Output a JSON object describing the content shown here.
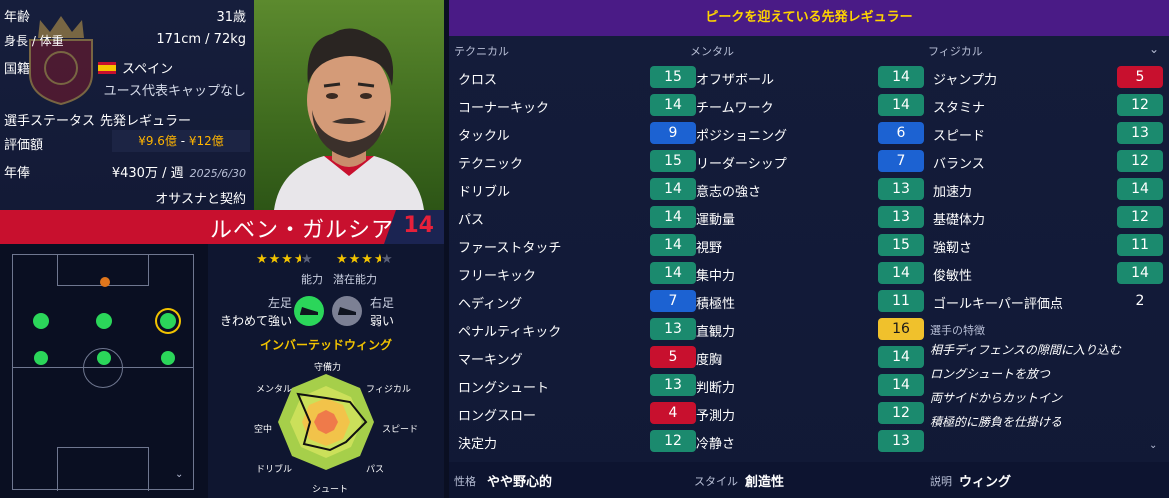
{
  "info": {
    "age_label": "年齢",
    "age_value": "31歳",
    "hw_label": "身長 / 体重",
    "hw_value": "171cm / 72kg",
    "nation_label": "国籍",
    "nation_value": "スペイン",
    "nation_sub": "ユース代表キャップなし",
    "status_label": "選手ステータス",
    "status_value": "先発レギュラー",
    "value_label": "評価額",
    "value_low": "¥9.6億",
    "value_sep": " - ",
    "value_high": "¥12億",
    "wage_label": "年俸",
    "wage_value": "¥430万 / 週",
    "wage_date": "2025/6/30",
    "contract": "オサスナと契約"
  },
  "player": {
    "name": "ルベン・ガルシア",
    "number": "14"
  },
  "ratings": {
    "ability_caption": "能力",
    "potential_caption": "潜在能力",
    "ability_stars": 3.5,
    "potential_stars": 3.5
  },
  "foot": {
    "left_label": "左足",
    "left_value": "きわめて強い",
    "right_label": "右足",
    "right_value": "弱い"
  },
  "role": "インバーテッドウィング",
  "radar": {
    "labels": [
      "守備力",
      "フィジカル",
      "スピード",
      "パス",
      "シュート",
      "ドリブル",
      "空中",
      "メンタル"
    ]
  },
  "banner": "ピークを迎えている先発レギュラー",
  "columns": {
    "technical": "テクニカル",
    "mental": "メンタル",
    "physical": "フィジカル"
  },
  "technical": [
    {
      "name": "クロス",
      "value": "15",
      "color": "green"
    },
    {
      "name": "コーナーキック",
      "value": "14",
      "color": "green"
    },
    {
      "name": "タックル",
      "value": "9",
      "color": "blue"
    },
    {
      "name": "テクニック",
      "value": "15",
      "color": "green"
    },
    {
      "name": "ドリブル",
      "value": "14",
      "color": "green"
    },
    {
      "name": "パス",
      "value": "14",
      "color": "green"
    },
    {
      "name": "ファーストタッチ",
      "value": "14",
      "color": "green"
    },
    {
      "name": "フリーキック",
      "value": "14",
      "color": "green"
    },
    {
      "name": "ヘディング",
      "value": "7",
      "color": "blue"
    },
    {
      "name": "ペナルティキック",
      "value": "13",
      "color": "green"
    },
    {
      "name": "マーキング",
      "value": "5",
      "color": "red"
    },
    {
      "name": "ロングシュート",
      "value": "13",
      "color": "green"
    },
    {
      "name": "ロングスロー",
      "value": "4",
      "color": "red"
    },
    {
      "name": "決定力",
      "value": "12",
      "color": "green"
    }
  ],
  "mental": [
    {
      "name": "オフザボール",
      "value": "14",
      "color": "green"
    },
    {
      "name": "チームワーク",
      "value": "14",
      "color": "green"
    },
    {
      "name": "ポジショニング",
      "value": "6",
      "color": "blue"
    },
    {
      "name": "リーダーシップ",
      "value": "7",
      "color": "blue"
    },
    {
      "name": "意志の強さ",
      "value": "13",
      "color": "green"
    },
    {
      "name": "運動量",
      "value": "13",
      "color": "green"
    },
    {
      "name": "視野",
      "value": "15",
      "color": "green"
    },
    {
      "name": "集中力",
      "value": "14",
      "color": "green"
    },
    {
      "name": "積極性",
      "value": "11",
      "color": "green"
    },
    {
      "name": "直観力",
      "value": "16",
      "color": "gold"
    },
    {
      "name": "度胸",
      "value": "14",
      "color": "green"
    },
    {
      "name": "判断力",
      "value": "14",
      "color": "green"
    },
    {
      "name": "予測力",
      "value": "12",
      "color": "green"
    },
    {
      "name": "冷静さ",
      "value": "13",
      "color": "green"
    }
  ],
  "physical": [
    {
      "name": "ジャンプ力",
      "value": "5",
      "color": "red"
    },
    {
      "name": "スタミナ",
      "value": "12",
      "color": "green"
    },
    {
      "name": "スピード",
      "value": "13",
      "color": "green"
    },
    {
      "name": "バランス",
      "value": "12",
      "color": "green"
    },
    {
      "name": "加速力",
      "value": "14",
      "color": "green"
    },
    {
      "name": "基礎体力",
      "value": "12",
      "color": "green"
    },
    {
      "name": "強靭さ",
      "value": "11",
      "color": "green"
    },
    {
      "name": "俊敏性",
      "value": "14",
      "color": "green"
    },
    {
      "name": "ゴールキーパー評価点",
      "value": "2",
      "color": "none"
    }
  ],
  "traits": {
    "heading": "選手の特徴",
    "items": [
      "相手ディフェンスの隙間に入り込む",
      "ロングシュートを放つ",
      "両サイドからカットイン",
      "積極的に勝負を仕掛ける"
    ]
  },
  "bottom": {
    "personality_label": "性格",
    "personality_value": "やや野心的",
    "style_label": "スタイル",
    "style_value": "創造性",
    "desc_label": "説明",
    "desc_value": "ウィング"
  },
  "colors": {
    "green": "#1b8a6e",
    "blue": "#1c62d2",
    "red": "#c8102e",
    "gold": "#f0c12c",
    "banner": "#4a1b86",
    "accent": "#f2c300"
  }
}
